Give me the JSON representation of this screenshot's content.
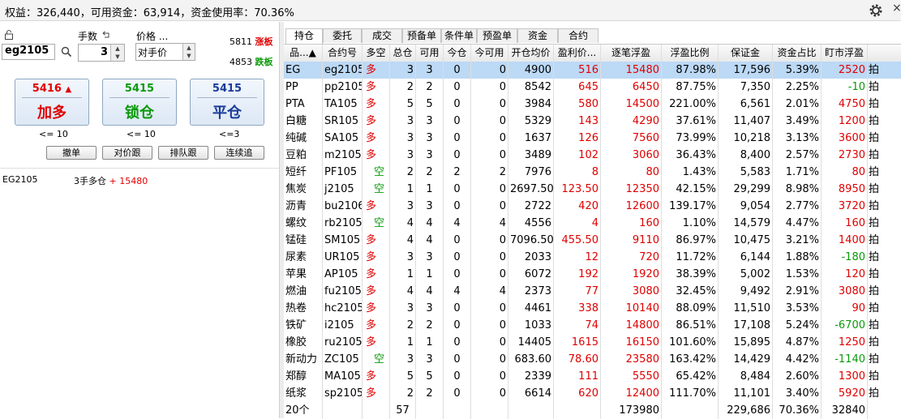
{
  "header": {
    "status_text": "权益：326,440，可用资金：63,914，资金使用率：70.36%",
    "settings_icon": "gear-icon",
    "close_text": "×"
  },
  "order_panel": {
    "lock_icon": "lock-icon",
    "qty_label": "手数",
    "price_label": "价格 ...",
    "symbol": "eg2105",
    "qty": "3",
    "price_type": "对手价",
    "limit_up_price": "5811",
    "limit_up_label": "涨板",
    "limit_down_price": "4853",
    "limit_down_label": "跌板",
    "buy": {
      "price": "5416",
      "arrow": "▲",
      "label": "加多",
      "limit": "<= 10"
    },
    "lock": {
      "price": "5415",
      "label": "锁仓",
      "limit": "<= 10"
    },
    "close": {
      "price": "5415",
      "label": "平仓",
      "limit": "<=3"
    },
    "buttons": [
      "撤单",
      "对价跟",
      "排队跟",
      "连续追"
    ],
    "position_line": {
      "symbol": "EG2105",
      "desc": "3手多仓",
      "pnl": "+ 15480"
    }
  },
  "tabs": [
    "持仓",
    "委托",
    "成交",
    "预备单",
    "条件单",
    "预盈单",
    "资金",
    "合约"
  ],
  "table": {
    "columns": [
      "品...▲",
      "合约号",
      "多空",
      "总仓",
      "可用",
      "今仓",
      "今可用",
      "开仓均价",
      "盈利价...",
      "逐笔浮盈",
      "浮盈比例",
      "保证金",
      "资金占比",
      "盯市浮盈"
    ],
    "rows": [
      [
        "EG",
        "eg2105",
        "多",
        "3",
        "3",
        "0",
        "0",
        "4900",
        "516",
        "15480",
        "87.98%",
        "17,596",
        "5.39%",
        "2520"
      ],
      [
        "PP",
        "pp2105",
        "多",
        "2",
        "2",
        "0",
        "0",
        "8542",
        "645",
        "6450",
        "87.75%",
        "7,350",
        "2.25%",
        "-10"
      ],
      [
        "PTA",
        "TA105",
        "多",
        "5",
        "5",
        "0",
        "0",
        "3984",
        "580",
        "14500",
        "221.00%",
        "6,561",
        "2.01%",
        "4750"
      ],
      [
        "白糖",
        "SR105",
        "多",
        "3",
        "3",
        "0",
        "0",
        "5329",
        "143",
        "4290",
        "37.61%",
        "11,407",
        "3.49%",
        "1200"
      ],
      [
        "纯碱",
        "SA105",
        "多",
        "3",
        "3",
        "0",
        "0",
        "1637",
        "126",
        "7560",
        "73.99%",
        "10,218",
        "3.13%",
        "3600"
      ],
      [
        "豆粕",
        "m2105",
        "多",
        "3",
        "3",
        "0",
        "0",
        "3489",
        "102",
        "3060",
        "36.43%",
        "8,400",
        "2.57%",
        "2730"
      ],
      [
        "短纤",
        "PF105",
        "空",
        "2",
        "2",
        "2",
        "2",
        "7976",
        "8",
        "80",
        "1.43%",
        "5,583",
        "1.71%",
        "80"
      ],
      [
        "焦炭",
        "j2105",
        "空",
        "1",
        "1",
        "0",
        "0",
        "2697.50",
        "123.50",
        "12350",
        "42.15%",
        "29,299",
        "8.98%",
        "8950"
      ],
      [
        "沥青",
        "bu2106",
        "多",
        "3",
        "3",
        "0",
        "0",
        "2722",
        "420",
        "12600",
        "139.17%",
        "9,054",
        "2.77%",
        "3720"
      ],
      [
        "螺纹",
        "rb2105",
        "空",
        "4",
        "4",
        "4",
        "4",
        "4556",
        "4",
        "160",
        "1.10%",
        "14,579",
        "4.47%",
        "160"
      ],
      [
        "锰硅",
        "SM105",
        "多",
        "4",
        "4",
        "0",
        "0",
        "7096.50",
        "455.50",
        "9110",
        "86.97%",
        "10,475",
        "3.21%",
        "1400"
      ],
      [
        "尿素",
        "UR105",
        "多",
        "3",
        "3",
        "0",
        "0",
        "2033",
        "12",
        "720",
        "11.72%",
        "6,144",
        "1.88%",
        "-180"
      ],
      [
        "苹果",
        "AP105",
        "多",
        "1",
        "1",
        "0",
        "0",
        "6072",
        "192",
        "1920",
        "38.39%",
        "5,002",
        "1.53%",
        "120"
      ],
      [
        "燃油",
        "fu2105",
        "多",
        "4",
        "4",
        "4",
        "4",
        "2373",
        "77",
        "3080",
        "32.45%",
        "9,492",
        "2.91%",
        "3080"
      ],
      [
        "热卷",
        "hc2105",
        "多",
        "3",
        "3",
        "0",
        "0",
        "4461",
        "338",
        "10140",
        "88.09%",
        "11,510",
        "3.53%",
        "90"
      ],
      [
        "铁矿",
        "i2105",
        "多",
        "2",
        "2",
        "0",
        "0",
        "1033",
        "74",
        "14800",
        "86.51%",
        "17,108",
        "5.24%",
        "-6700"
      ],
      [
        "橡胶",
        "ru2105",
        "多",
        "1",
        "1",
        "0",
        "0",
        "14405",
        "1615",
        "16150",
        "101.60%",
        "15,895",
        "4.87%",
        "1250"
      ],
      [
        "新动力",
        "ZC105",
        "空",
        "3",
        "3",
        "0",
        "0",
        "683.60",
        "78.60",
        "23580",
        "163.42%",
        "14,429",
        "4.42%",
        "-1140"
      ],
      [
        "郑醇",
        "MA105",
        "多",
        "5",
        "5",
        "0",
        "0",
        "2339",
        "111",
        "5550",
        "65.42%",
        "8,484",
        "2.60%",
        "1300"
      ],
      [
        "纸浆",
        "sp2105",
        "多",
        "2",
        "2",
        "0",
        "0",
        "6614",
        "620",
        "12400",
        "111.70%",
        "11,101",
        "3.40%",
        "5920"
      ]
    ],
    "row_suffix": "拍",
    "footer": [
      "20个",
      "",
      "",
      "57",
      "",
      "",
      "",
      "",
      "",
      "173980",
      "",
      "229,686",
      "70.36%",
      "32840"
    ]
  },
  "colors": {
    "red": "#e00000",
    "green": "#0a9a0a",
    "selected_row": "#bcd9f5"
  }
}
